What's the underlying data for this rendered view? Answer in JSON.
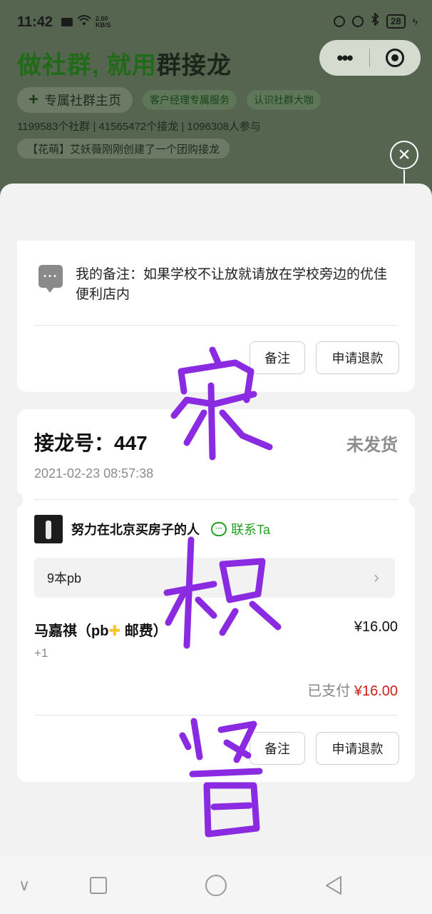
{
  "status_bar": {
    "time": "11:42",
    "net_speed_value": "2.00",
    "net_speed_unit": "KB/S",
    "battery": "28"
  },
  "background": {
    "brand_part1": "做社群, 就用",
    "brand_part2": "群接龙",
    "main_pill": "专属社群主页",
    "tag1": "客户经理专属服务",
    "tag2": "认识社群大咖",
    "stats": "1199583个社群 | 41565472个接龙 | 1096308人参与",
    "notice": "【花萌】艾妖薇刚刚创建了一个团购接龙"
  },
  "card1": {
    "note_label": "我的备注：如果学校不让放就请放在学校旁边的优佳便利店内",
    "remark_button": "备注",
    "refund_button": "申请退款"
  },
  "card2": {
    "order_no": "接龙号：447",
    "status": "未发货",
    "time": "2021-02-23 08:57:38",
    "user_name": "努力在北京买房子的人",
    "contact": "联系Ta",
    "product_summary": "9本pb",
    "item_name_a": "马嘉祺（pb",
    "item_name_b": "邮费）",
    "item_price": "¥16.00",
    "item_qty": "+1",
    "paid_label": "已支付",
    "paid_amount": "¥16.00",
    "remark_button": "备注",
    "refund_button": "申请退款"
  },
  "colors": {
    "brand_green": "#1f6b17",
    "contact_green": "#23a123",
    "price_red": "#d0201c",
    "handwriting_purple": "#8a2be2"
  },
  "icons": [
    "wifi-icon",
    "bluetooth-icon",
    "battery-icon",
    "more-icon",
    "target-icon",
    "close-icon",
    "comment-icon",
    "chat-icon",
    "chevron-right-icon",
    "nav-back-icon",
    "nav-square-icon",
    "nav-home-icon",
    "nav-recent-icon"
  ]
}
